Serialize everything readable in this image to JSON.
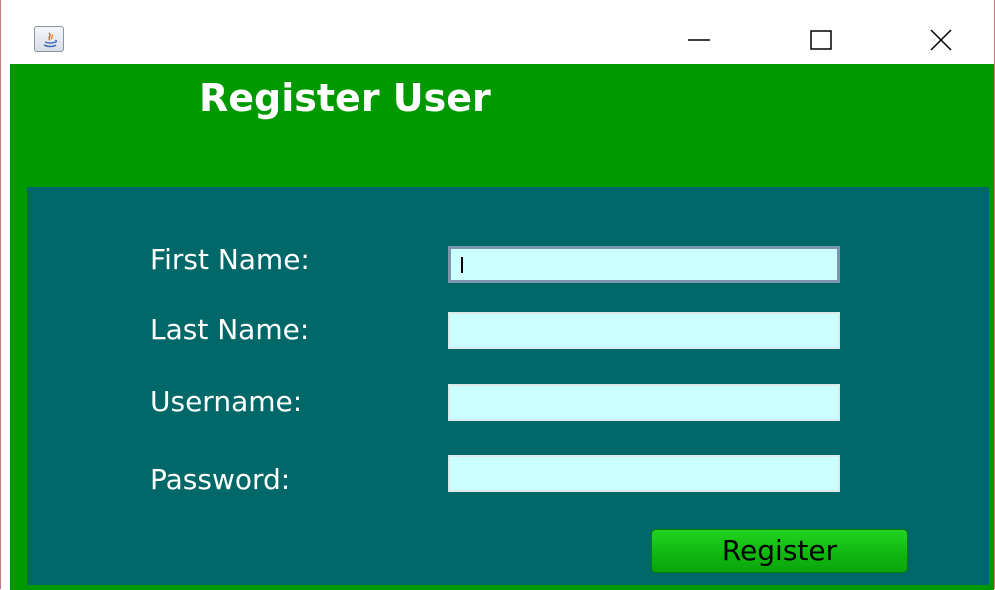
{
  "window": {
    "title": "",
    "controls": {
      "minimize": "minimize-icon",
      "maximize": "maximize-icon",
      "close": "close-icon"
    },
    "app_icon": "java-icon"
  },
  "header": {
    "title": "Register User",
    "background_color": "#009a00"
  },
  "form": {
    "background_color": "#006868",
    "fields": [
      {
        "label": "First Name:",
        "value": "",
        "focused": true
      },
      {
        "label": "Last Name:",
        "value": ""
      },
      {
        "label": "Username:",
        "value": ""
      },
      {
        "label": "Password:",
        "value": ""
      }
    ],
    "field_color": "#ccffff",
    "submit_label": "Register",
    "submit_color": "#10b910"
  }
}
